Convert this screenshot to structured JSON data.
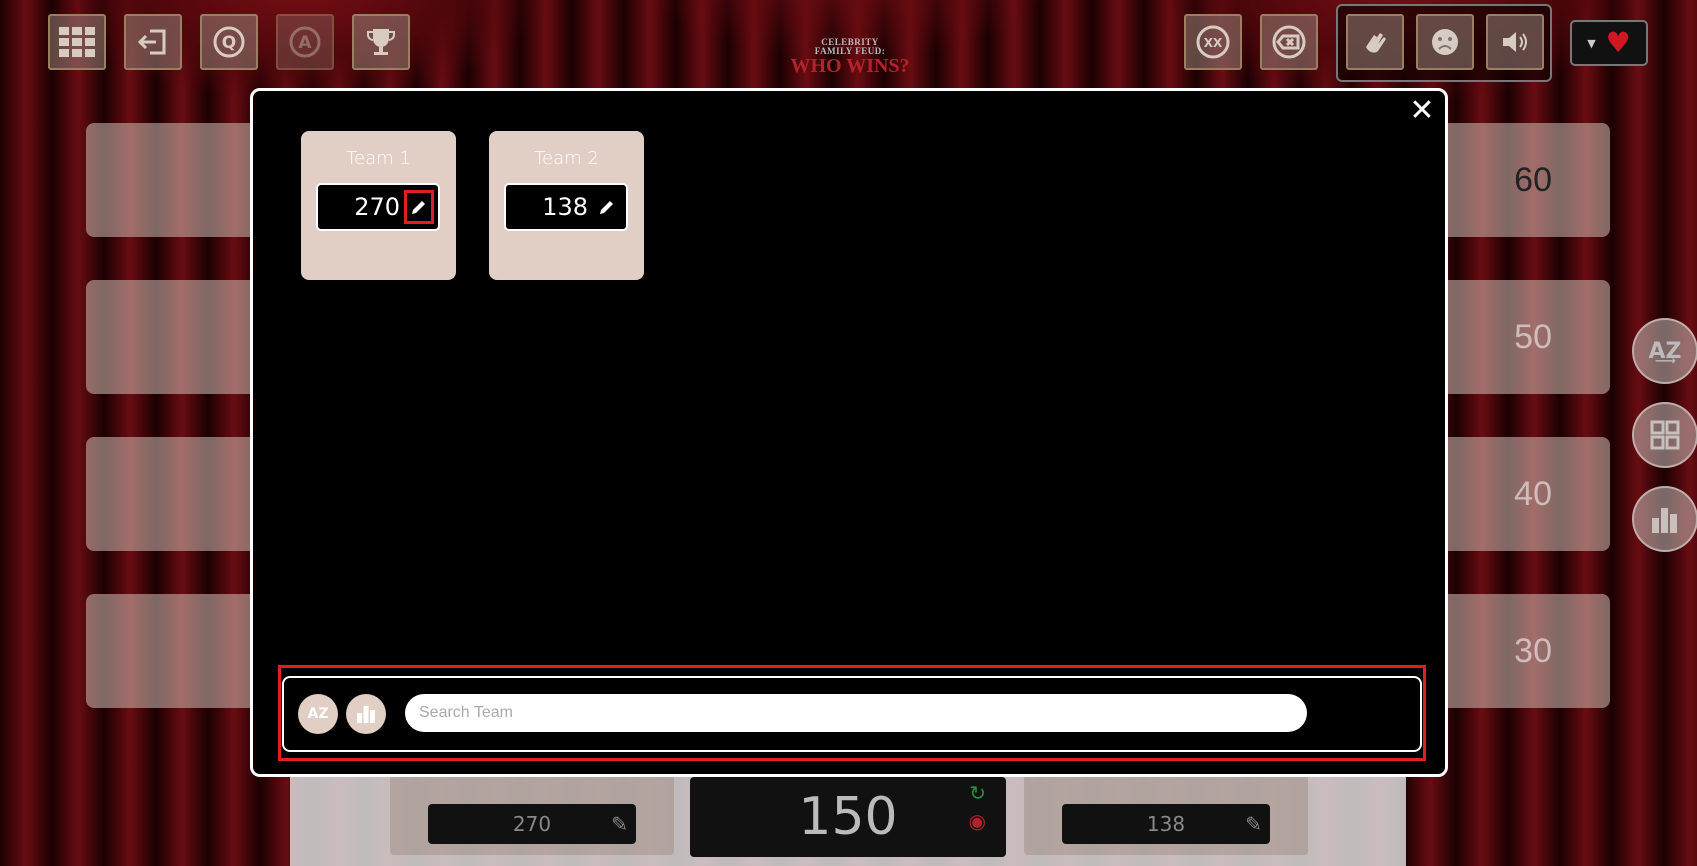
{
  "header": {
    "logo_line1": "CELEBRITY",
    "logo_line2": "FAMILY FEUD:",
    "logo_title": "WHO WINS?"
  },
  "toolbar": {
    "left_icons": [
      "grid-icon",
      "exit-icon",
      "question-icon",
      "answer-icon",
      "trophy-icon"
    ],
    "right_icons": [
      "strike-icon",
      "backspace-icon"
    ],
    "sound_icons": [
      "clap-icon",
      "sad-face-icon",
      "speaker-icon"
    ],
    "heart": "♥"
  },
  "board": {
    "values": [
      "60",
      "50",
      "40",
      "30"
    ]
  },
  "bottom": {
    "team1_score": "270",
    "team2_score": "138",
    "round_score": "150"
  },
  "modal": {
    "teams": [
      {
        "name": "Team 1",
        "score": "270"
      },
      {
        "name": "Team 2",
        "score": "138"
      }
    ],
    "sort_az_label": "AZ",
    "search_placeholder": "Search Team",
    "search_value": ""
  },
  "colors": {
    "card_bg": "#e1cfc5",
    "highlight": "#e02020",
    "curtain": "#a1141c"
  }
}
